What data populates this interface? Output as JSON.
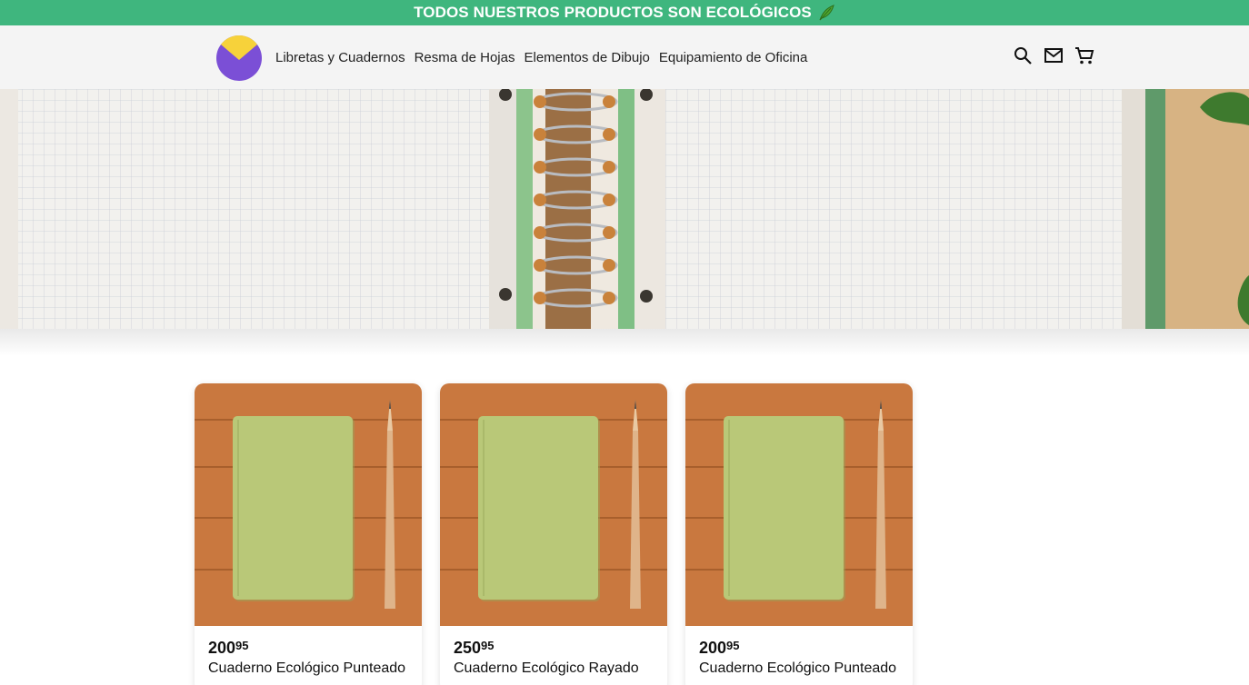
{
  "promo_banner": {
    "text": "TODOS NUESTROS PRODUCTOS SON ECOLÓGICOS",
    "icon": "leaf-icon"
  },
  "header": {
    "logo": "brand-logo",
    "nav": [
      {
        "label": "Libretas y Cuadernos"
      },
      {
        "label": "Resma de Hojas"
      },
      {
        "label": "Elementos de Dibujo"
      },
      {
        "label": "Equipamiento de Oficina"
      }
    ],
    "icons": [
      "search-icon",
      "mail-icon",
      "cart-icon"
    ]
  },
  "colors": {
    "promo_bg": "#3fb67e",
    "header_bg": "#f4f4f4",
    "logo_purple": "#7b4fd6",
    "logo_yellow": "#f7d23a",
    "wood": "#c9783f",
    "notebook_green": "#b9c878"
  },
  "products": [
    {
      "price_int": "200",
      "price_dec": "95",
      "name": "Cuaderno Ecológico Punteado"
    },
    {
      "price_int": "250",
      "price_dec": "95",
      "name": "Cuaderno Ecológico Rayado"
    },
    {
      "price_int": "200",
      "price_dec": "95",
      "name": "Cuaderno Ecológico Punteado"
    }
  ]
}
